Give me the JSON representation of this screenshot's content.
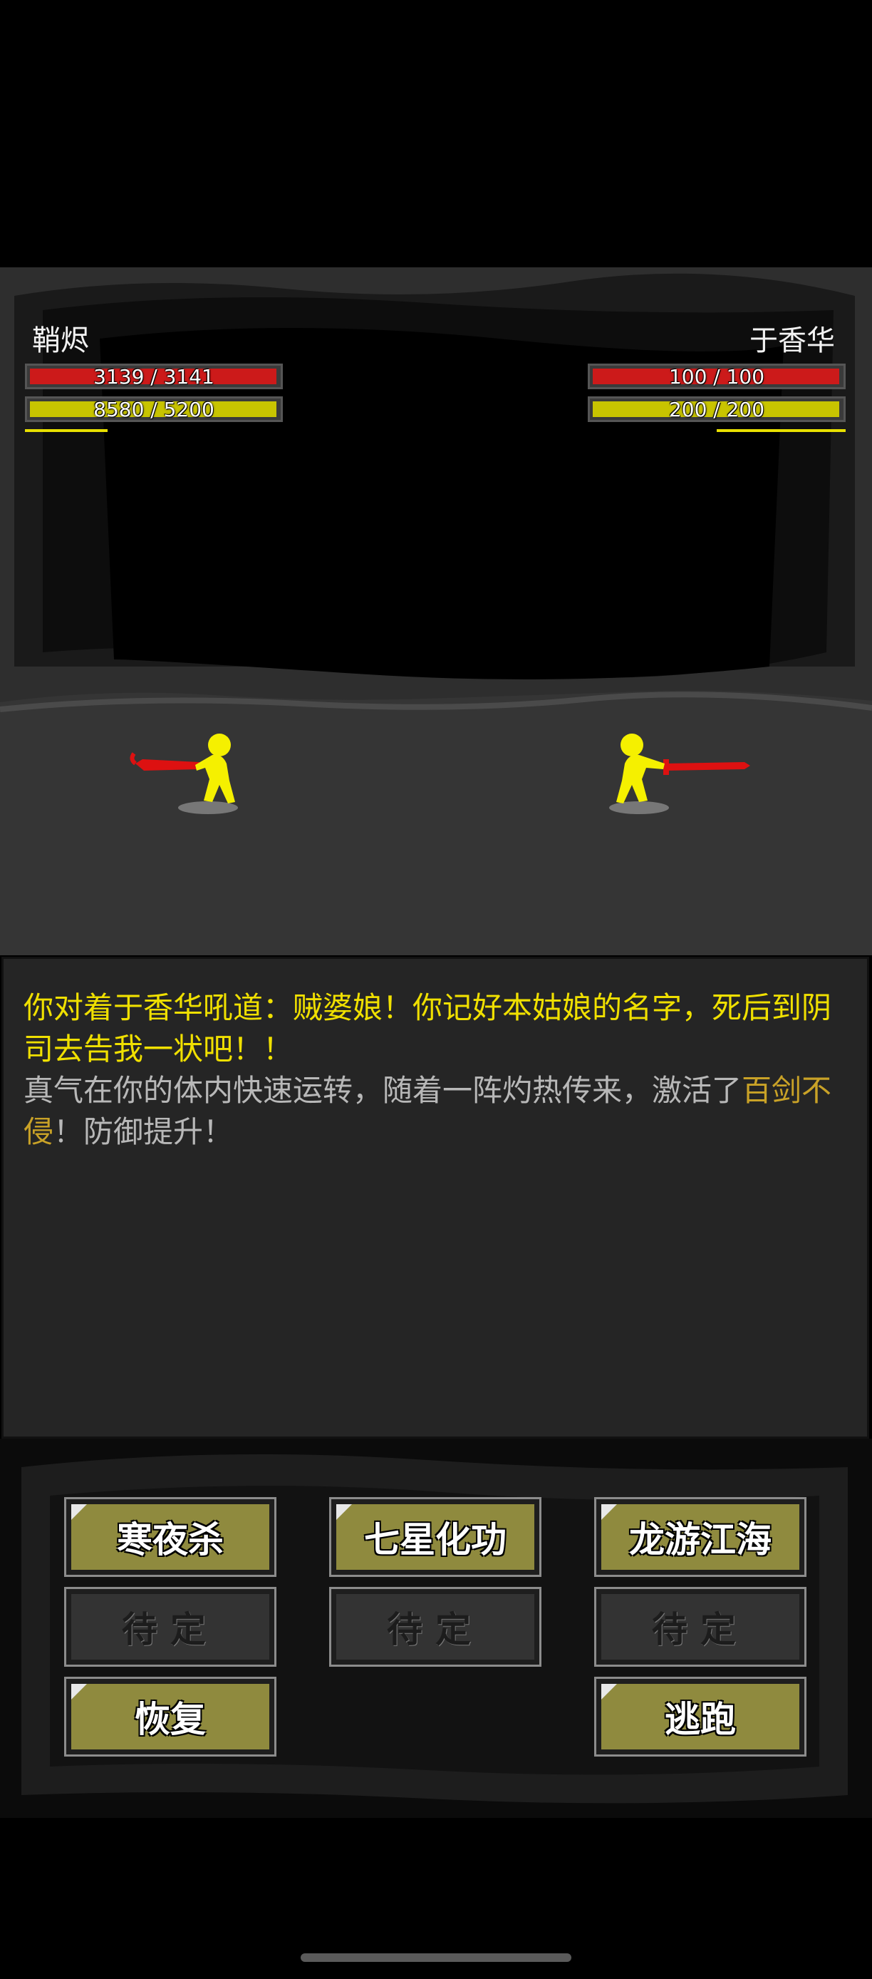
{
  "player": {
    "name": "鞘烬",
    "hp": {
      "text": "3139 / 3141",
      "fraction": 0.999
    },
    "mp": {
      "text": "8580 / 5200",
      "fraction": 1.0
    },
    "gauge_fraction": 0.32
  },
  "enemy": {
    "name": "于香华",
    "hp": {
      "text": "100 / 100",
      "fraction": 1.0
    },
    "mp": {
      "text": "200 / 200",
      "fraction": 1.0
    },
    "gauge_fraction": 0.5
  },
  "log": {
    "line1": "你对着于香华吼道：贼婆娘！你记好本姑娘的名字，死后到阴司去告我一状吧！！",
    "line2": "真气在你的体内快速运转，随着一阵灼热传来，激活了",
    "skill_name": "百剑不侵",
    "line2_end": "！防御提升！"
  },
  "buttons": {
    "skill1": "寒夜杀",
    "skill2": "七星化功",
    "skill3": "龙游江海",
    "empty1": "待定",
    "empty2": "待定",
    "empty3": "待定",
    "recover": "恢复",
    "flee": "逃跑"
  },
  "colors": {
    "hp": "#cc1a1a",
    "mp": "#c8c400",
    "dialog": "#f0e000",
    "skill_highlight": "#c9a227",
    "button": "#8f8a3e"
  }
}
